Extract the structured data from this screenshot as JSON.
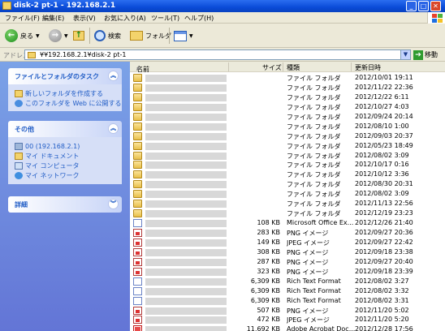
{
  "window": {
    "title": "disk-2 pt-1 - 192.168.2.1",
    "minimize": "_",
    "maximize": "□",
    "close": "✕"
  },
  "menu": [
    "ファイル(F)",
    "編集(E)",
    "表示(V)",
    "お気に入り(A)",
    "ツール(T)",
    "ヘルプ(H)"
  ],
  "toolbar": {
    "back": "戻る",
    "search": "検索",
    "folders": "フォルダ"
  },
  "address": {
    "label": "アドレス(D)",
    "value": "¥¥192.168.2.1¥disk-2 pt-1",
    "go": "移動"
  },
  "tasks": {
    "file_tasks": {
      "title": "ファイルとフォルダのタスク",
      "items": [
        "新しいフォルダを作成する",
        "このフォルダを Web に公開する"
      ]
    },
    "other": {
      "title": "その他",
      "items": [
        "00 (192.168.2.1)",
        "マイ ドキュメント",
        "マイ コンピュータ",
        "マイ ネットワーク"
      ]
    },
    "details": {
      "title": "詳細"
    }
  },
  "columns": {
    "name": "名前",
    "size": "サイズ",
    "type": "種類",
    "modified": "更新日時"
  },
  "files": [
    {
      "icon": "folder",
      "size": "",
      "type": "ファイル フォルダ",
      "date": "2012/10/01 19:11"
    },
    {
      "icon": "folder",
      "size": "",
      "type": "ファイル フォルダ",
      "date": "2012/11/22 22:36"
    },
    {
      "icon": "folder",
      "size": "",
      "type": "ファイル フォルダ",
      "date": "2012/12/22 6:11"
    },
    {
      "icon": "folder",
      "size": "",
      "type": "ファイル フォルダ",
      "date": "2012/10/27 4:03"
    },
    {
      "icon": "folder",
      "size": "",
      "type": "ファイル フォルダ",
      "date": "2012/09/24 20:14"
    },
    {
      "icon": "folder",
      "size": "",
      "type": "ファイル フォルダ",
      "date": "2012/08/10 1:00"
    },
    {
      "icon": "folder",
      "size": "",
      "type": "ファイル フォルダ",
      "date": "2012/09/03 20:37"
    },
    {
      "icon": "folder",
      "size": "",
      "type": "ファイル フォルダ",
      "date": "2012/05/23 18:49"
    },
    {
      "icon": "folder",
      "size": "",
      "type": "ファイル フォルダ",
      "date": "2012/08/02 3:09"
    },
    {
      "icon": "folder",
      "size": "",
      "type": "ファイル フォルダ",
      "date": "2012/10/17 0:16"
    },
    {
      "icon": "folder",
      "size": "",
      "type": "ファイル フォルダ",
      "date": "2012/10/12 3:36"
    },
    {
      "icon": "folder",
      "size": "",
      "type": "ファイル フォルダ",
      "date": "2012/08/30 20:31"
    },
    {
      "icon": "folder",
      "size": "",
      "type": "ファイル フォルダ",
      "date": "2012/08/02 3:09"
    },
    {
      "icon": "folder",
      "size": "",
      "type": "ファイル フォルダ",
      "date": "2012/11/13 22:56"
    },
    {
      "icon": "folder",
      "size": "",
      "type": "ファイル フォルダ",
      "date": "2012/12/19 23:23"
    },
    {
      "icon": "doc",
      "size": "108 KB",
      "type": "Microsoft Office Ex...",
      "date": "2012/12/26 21:40"
    },
    {
      "icon": "img",
      "size": "283 KB",
      "type": "PNG イメージ",
      "date": "2012/09/27 20:36"
    },
    {
      "icon": "img",
      "size": "149 KB",
      "type": "JPEG イメージ",
      "date": "2012/09/27 22:42"
    },
    {
      "icon": "img",
      "size": "308 KB",
      "type": "PNG イメージ",
      "date": "2012/09/18 23:38"
    },
    {
      "icon": "img",
      "size": "287 KB",
      "type": "PNG イメージ",
      "date": "2012/09/27 20:40"
    },
    {
      "icon": "img",
      "size": "323 KB",
      "type": "PNG イメージ",
      "date": "2012/09/18 23:39"
    },
    {
      "icon": "doc",
      "size": "6,309 KB",
      "type": "Rich Text Format",
      "date": "2012/08/02 3:27"
    },
    {
      "icon": "doc",
      "size": "6,309 KB",
      "type": "Rich Text Format",
      "date": "2012/08/02 3:32"
    },
    {
      "icon": "doc",
      "size": "6,309 KB",
      "type": "Rich Text Format",
      "date": "2012/08/02 3:31"
    },
    {
      "icon": "img",
      "size": "507 KB",
      "type": "PNG イメージ",
      "date": "2012/11/20 5:02"
    },
    {
      "icon": "img",
      "size": "472 KB",
      "type": "JPEG イメージ",
      "date": "2012/11/20 5:20"
    },
    {
      "icon": "pdf",
      "size": "11,692 KB",
      "type": "Adobe Acrobat Doc...",
      "date": "2012/12/28 17:56"
    }
  ]
}
